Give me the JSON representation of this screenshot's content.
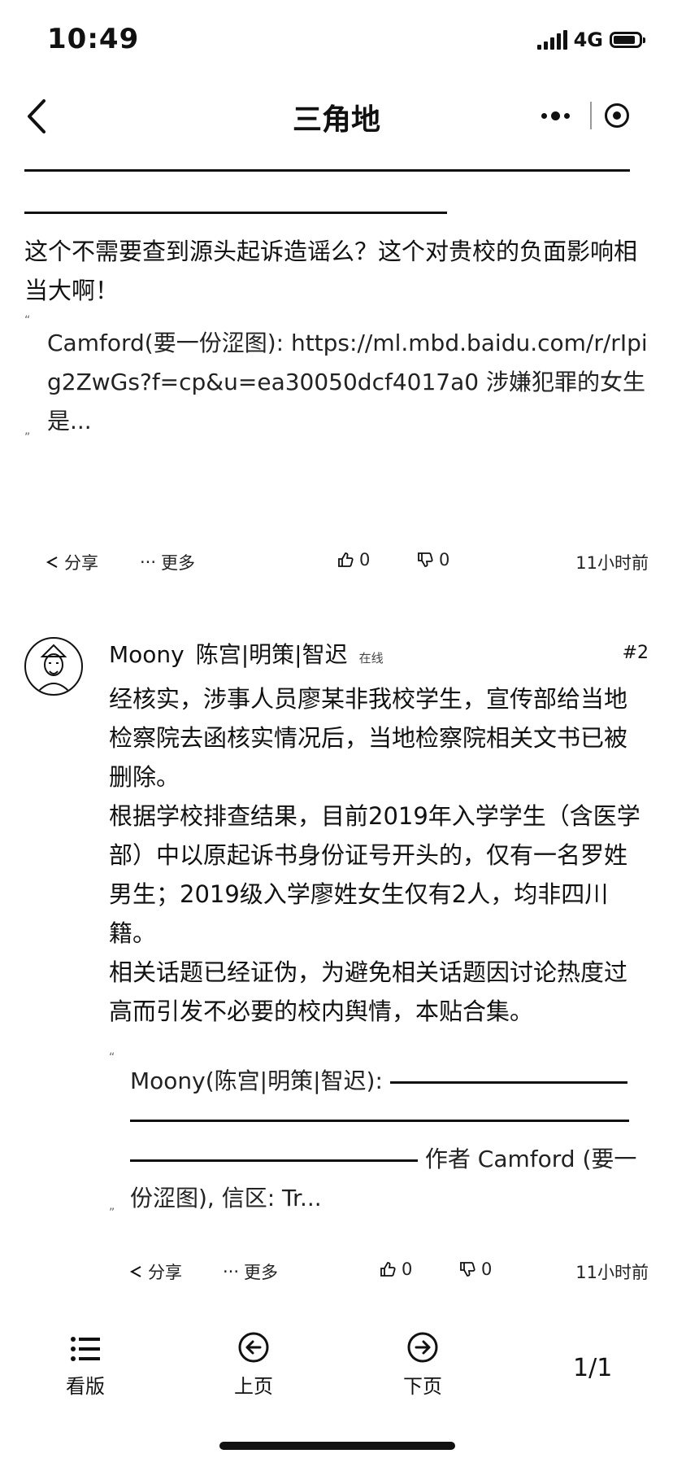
{
  "status_bar": {
    "time": "10:49",
    "network": "4G"
  },
  "nav": {
    "title": "三角地"
  },
  "post1": {
    "text": "这个不需要查到源头起诉造谣么？这个对贵校的负面影响相当大啊！",
    "quote": "Camford(要一份涩图): https://ml.mbd.baidu.com/r/rIpig2ZwGs?f=cp&u=ea30050dcf4017a0 涉嫌犯罪的女生是...",
    "actions": {
      "share": "分享",
      "more": "更多",
      "likes": "0",
      "dislikes": "0",
      "time": "11小时前"
    }
  },
  "post2": {
    "author": "Moony",
    "title": "陈宫|明策|智迟",
    "status": "在线",
    "floor": "#2",
    "paragraphs": [
      "经核实，涉事人员廖某非我校学生，宣传部给当地检察院去函核实情况后，当地检察院相关文书已被删除。",
      "根据学校排查结果，目前2019年入学学生（含医学部）中以原起诉书身份证号开头的，仅有一名罗姓男生；2019级入学廖姓女生仅有2人，均非四川籍。",
      "相关话题已经证伪，为避免相关话题因讨论热度过高而引发不必要的校内舆情，本贴合集。"
    ],
    "quote_prefix": "Moony(陈宫|明策|智迟):",
    "quote_suffix": "作者 Camford (要一份涩图), 信区: Tr...",
    "actions": {
      "share": "分享",
      "more": "更多",
      "likes": "0",
      "dislikes": "0",
      "time": "11小时前"
    }
  },
  "bottom_bar": {
    "board": "看版",
    "prev": "上页",
    "next": "下页",
    "page": "1/1"
  }
}
